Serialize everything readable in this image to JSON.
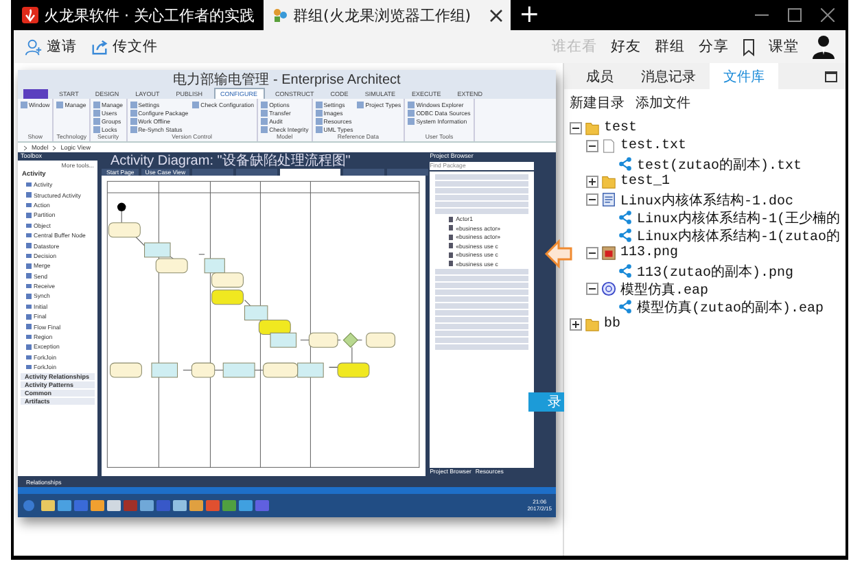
{
  "tabs": [
    {
      "label": "火龙果软件 · 关心工作者的实践",
      "selected": false,
      "closable": false
    },
    {
      "label": "群组(火龙果浏览器工作组)",
      "selected": true,
      "closable": true
    }
  ],
  "new_tab": "+",
  "toolbar": {
    "left": [
      {
        "kind": "invite",
        "label": "邀请"
      },
      {
        "kind": "upload",
        "label": "传文件"
      }
    ],
    "right": [
      {
        "kind": "link",
        "label": "谁在看",
        "disabled": true
      },
      {
        "kind": "link",
        "label": "好友",
        "disabled": false
      },
      {
        "kind": "link",
        "label": "群组",
        "disabled": false
      },
      {
        "kind": "link",
        "label": "分享",
        "disabled": false
      },
      {
        "kind": "bookmark"
      },
      {
        "kind": "link",
        "label": "课堂",
        "disabled": false
      },
      {
        "kind": "avatar"
      }
    ]
  },
  "preview": {
    "title": "电力部输电管理 - Enterprise Architect",
    "ribbon_tabs": [
      {
        "label": "START",
        "selected": false
      },
      {
        "label": "DESIGN",
        "selected": false
      },
      {
        "label": "LAYOUT",
        "selected": false
      },
      {
        "label": "PUBLISH",
        "selected": false
      },
      {
        "label": "CONFIGURE",
        "selected": true
      },
      {
        "label": "CONSTRUCT",
        "selected": false
      },
      {
        "label": "CODE",
        "selected": false
      },
      {
        "label": "SIMULATE",
        "selected": false
      },
      {
        "label": "EXECUTE",
        "selected": false
      },
      {
        "label": "EXTEND",
        "selected": false
      }
    ],
    "ribbon_groups": [
      {
        "label": "Show",
        "buttons": [
          "Window"
        ]
      },
      {
        "label": "Technology",
        "buttons": [
          "Manage"
        ]
      },
      {
        "label": "Security",
        "buttons": [
          "Manage",
          "Users",
          "Groups",
          "Locks"
        ]
      },
      {
        "label": "Version Control",
        "buttons": [
          "Settings",
          "Configure Package",
          "Work Offline",
          "Re-Synch Status",
          "Check Configuration"
        ]
      },
      {
        "label": "Model",
        "buttons": [
          "Options",
          "Transfer",
          "Audit",
          "Check Integrity"
        ]
      },
      {
        "label": "Reference Data",
        "buttons": [
          "Settings",
          "Images",
          "Resources",
          "UML Types",
          "Project Types"
        ]
      },
      {
        "label": "User Tools",
        "buttons": [
          "Windows Explorer",
          "ODBC Data Sources",
          "System Information"
        ]
      }
    ],
    "breadcrumb": [
      "Model",
      "Logic View"
    ],
    "toolbox": {
      "title": "Toolbox",
      "more": "More tools...",
      "section": "Activity",
      "items": [
        "Activity",
        "Structured Activity",
        "Action",
        "Partition",
        "Object",
        "Central Buffer Node",
        "Datastore",
        "Decision",
        "Merge",
        "Send",
        "Receive",
        "Synch",
        "Initial",
        "Final",
        "Flow Final",
        "Region",
        "Exception",
        "ForkJoin",
        "ForkJoin"
      ],
      "collapsed_sections": [
        "Activity Relationships",
        "Activity Patterns",
        "Common",
        "Artifacts"
      ]
    },
    "diagram_title": "Activity Diagram: \"设备缺陷处理流程图\"",
    "doc_tabs": [
      "Start Page",
      "Use Case View"
    ],
    "browser": {
      "title": "Project Browser",
      "search": "Find Package",
      "items": [
        "Actor1",
        "«business actor»",
        "«business actor»",
        "«business use c",
        "«business use c",
        "«business use c"
      ],
      "tabs": [
        "Project Browser",
        "Resources"
      ]
    },
    "relationships": "Relationships",
    "clock": {
      "time": "21:06",
      "date": "2017/2/15"
    }
  },
  "hidden_button": "录",
  "panel": {
    "tabs": [
      {
        "label": "成员",
        "selected": false
      },
      {
        "label": "消息记录",
        "selected": false
      },
      {
        "label": "文件库",
        "selected": true
      }
    ],
    "actions": [
      "新建目录",
      "添加文件"
    ],
    "tree": [
      {
        "kind": "folder",
        "label": "test",
        "expanded": true,
        "children": [
          {
            "kind": "txt",
            "label": "test.txt",
            "expanded": true,
            "children": [
              {
                "kind": "share",
                "label": "test(zutao的副本).txt"
              }
            ]
          },
          {
            "kind": "folder",
            "label": "test_1",
            "expanded": false
          },
          {
            "kind": "doc",
            "label": "Linux内核体系结构-1.doc",
            "expanded": true,
            "children": [
              {
                "kind": "share",
                "label": "Linux内核体系结构-1(王少楠的"
              },
              {
                "kind": "share",
                "label": "Linux内核体系结构-1(zutao的"
              }
            ]
          },
          {
            "kind": "png",
            "label": "113.png",
            "expanded": true,
            "children": [
              {
                "kind": "share",
                "label": "113(zutao的副本).png"
              }
            ]
          },
          {
            "kind": "eap",
            "label": "模型仿真.eap",
            "expanded": true,
            "children": [
              {
                "kind": "share",
                "label": "模型仿真(zutao的副本).eap"
              }
            ]
          }
        ]
      },
      {
        "kind": "folder",
        "label": "bb",
        "expanded": false
      }
    ]
  }
}
